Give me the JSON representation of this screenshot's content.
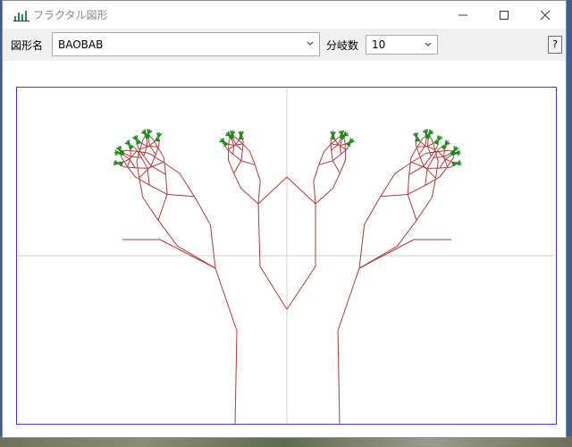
{
  "window": {
    "title": "フラクタル図形"
  },
  "toolbar": {
    "shape_label": "図形名",
    "shape_value": "BAOBAB",
    "branch_label": "分岐数",
    "branch_value": "10",
    "help_label": "?"
  },
  "fractal": {
    "trunk_color": "#b23a3a",
    "leaf_color": "#1b8a1b",
    "axis_color": "#d0d0d0",
    "frame_color": "#3c3cd0"
  }
}
